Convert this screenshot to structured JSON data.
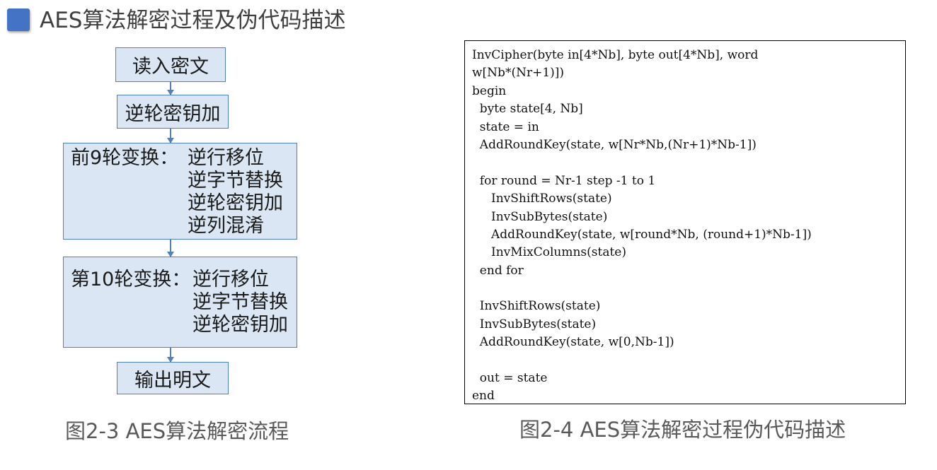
{
  "header": {
    "title": "AES算法解密过程及伪代码描述",
    "accent_color": "#4472c4"
  },
  "flowchart": {
    "read_ciphertext": "读入密文",
    "initial_add_round_key": "逆轮密钥加",
    "rounds_1_to_9": {
      "label": "前9轮变换：",
      "steps": [
        "逆行移位",
        "逆字节替换",
        "逆轮密钥加",
        "逆列混淆"
      ]
    },
    "round_10": {
      "label": "第10轮变换：",
      "steps": [
        "逆行移位",
        "逆字节替换",
        "逆轮密钥加"
      ]
    },
    "output_plaintext": "输出明文",
    "box_fill_color": "#dae6f3",
    "box_border_color": "#4f81bd",
    "caption": "图2-3 AES算法解密流程"
  },
  "pseudocode": {
    "lines": [
      "InvCipher(byte in[4*Nb], byte out[4*Nb], word",
      "w[Nb*(Nr+1)])",
      "begin",
      "  byte state[4, Nb]",
      "  state = in",
      "  AddRoundKey(state, w[Nr*Nb,(Nr+1)*Nb-1])",
      "",
      "  for round = Nr-1 step -1 to 1",
      "     InvShiftRows(state)",
      "     InvSubBytes(state)",
      "     AddRoundKey(state, w[round*Nb, (round+1)*Nb-1])",
      "     InvMixColumns(state)",
      "  end for",
      "",
      "  InvShiftRows(state)",
      "  InvSubBytes(state)",
      "  AddRoundKey(state, w[0,Nb-1])",
      "",
      "  out = state",
      "end"
    ],
    "caption": "图2-4 AES算法解密过程伪代码描述"
  }
}
